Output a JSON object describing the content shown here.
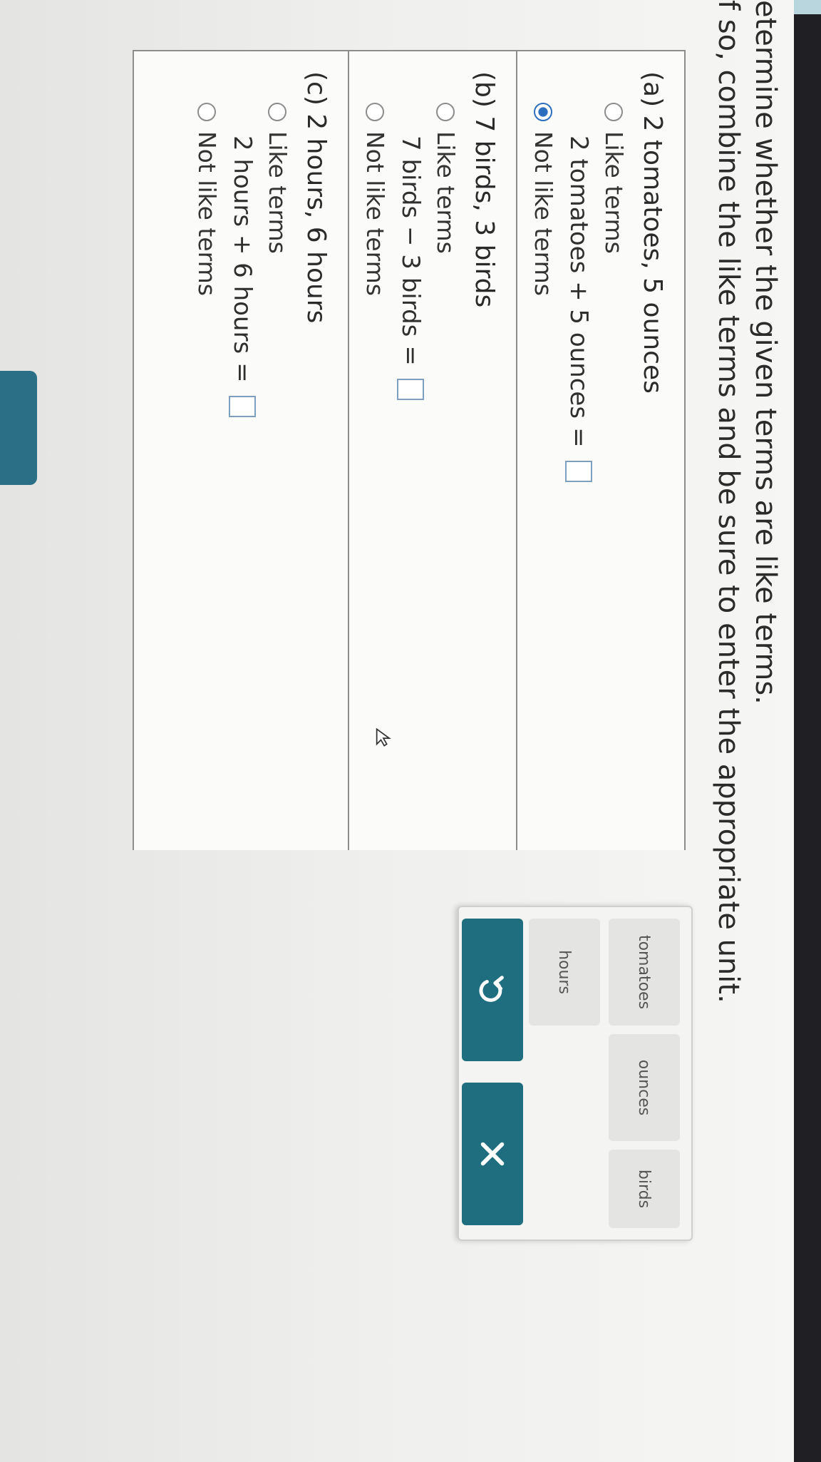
{
  "instructions": {
    "line1": "etermine whether the given terms are like terms.",
    "line2": "f so, combine the like terms and be sure to enter the appropriate unit."
  },
  "questions": [
    {
      "title": "(a) 2 tomatoes, 5 ounces",
      "option_like": "Like terms",
      "option_not_like": "Not like terms",
      "selected": "Not like terms",
      "equation_left": "2 tomatoes + 5 ounces",
      "equals": "="
    },
    {
      "title": "(b) 7 birds, 3 birds",
      "option_like": "Like terms",
      "option_not_like": "Not like terms",
      "selected": "",
      "equation_left": "7 birds − 3 birds",
      "equals": "="
    },
    {
      "title": "(c) 2 hours, 6 hours",
      "option_like": "Like terms",
      "option_not_like": "Not like terms",
      "selected": "",
      "equation_left": "2 hours + 6 hours",
      "equals": "="
    }
  ],
  "keypad": {
    "units": [
      "tomatoes",
      "ounces",
      "birds",
      "hours",
      "",
      ""
    ],
    "undo_icon": "undo-icon",
    "clear_icon": "clear-icon"
  },
  "colors": {
    "accent": "#1e6e7f",
    "radio_selected": "#2c6fbf"
  }
}
